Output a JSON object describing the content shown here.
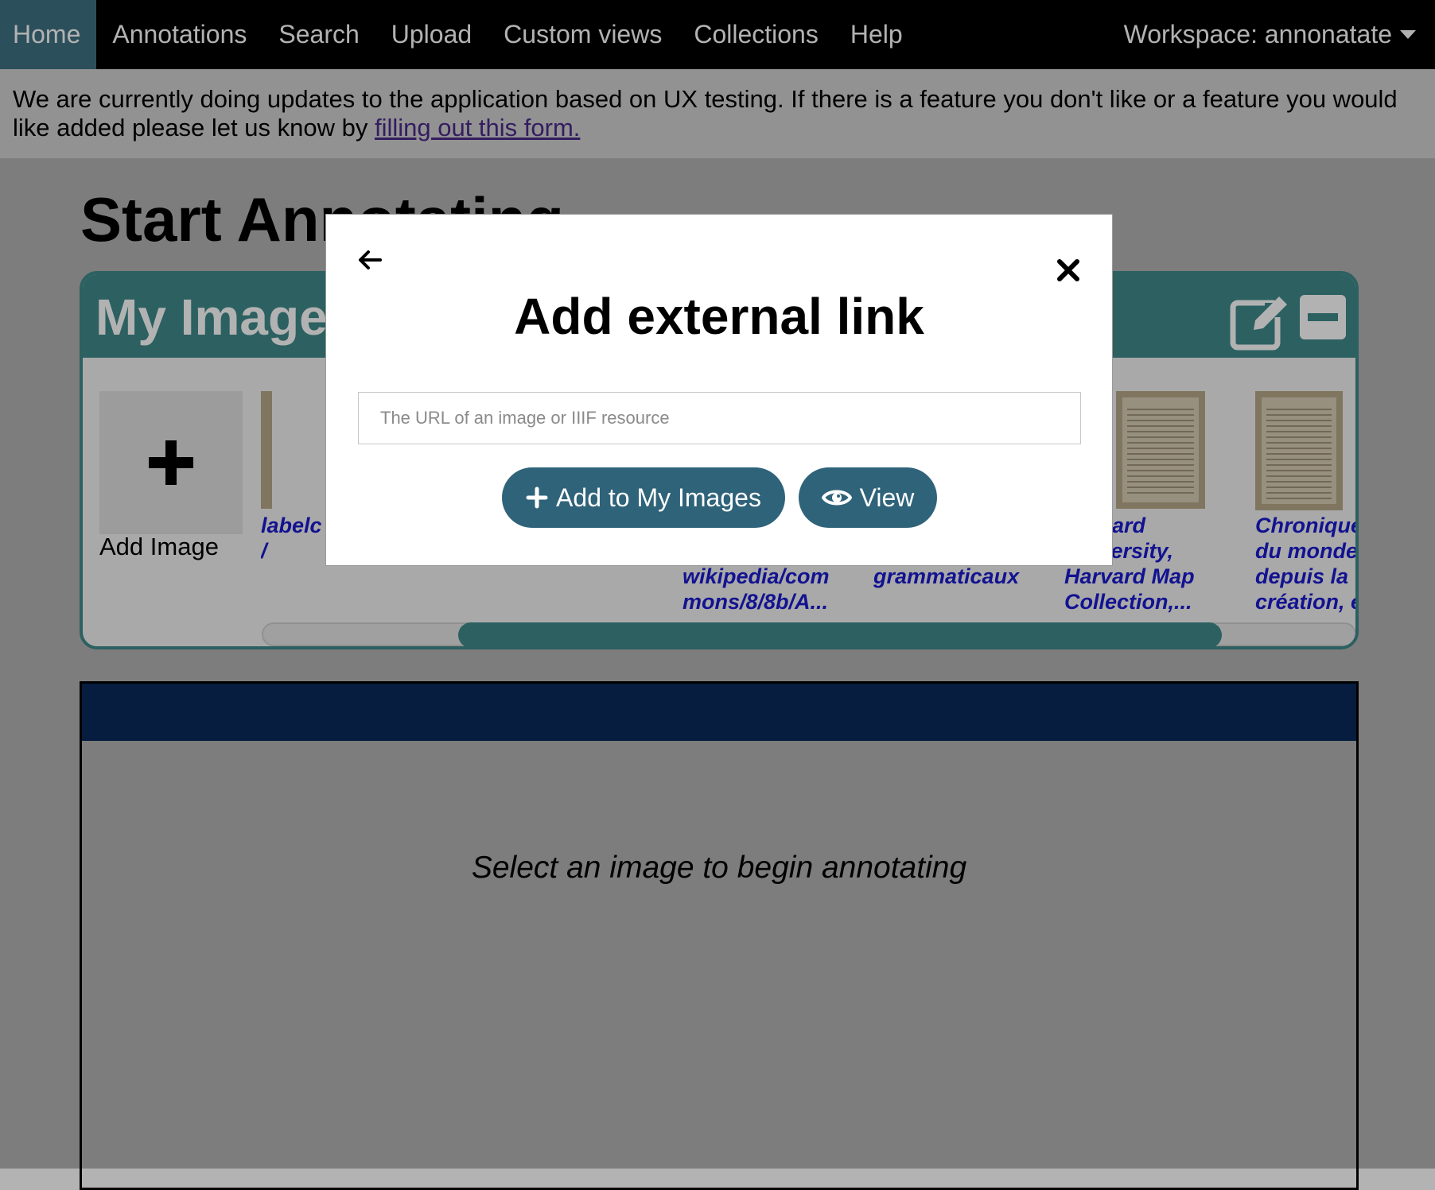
{
  "nav": {
    "items": [
      "Home",
      "Annotations",
      "Search",
      "Upload",
      "Custom views",
      "Collections",
      "Help"
    ],
    "active": "Home",
    "workspace": "Workspace: annonatate"
  },
  "banner": {
    "text": "We are currently doing updates to the application based on UX testing. If there is a feature you don't like or a feature you would like added please let us know by ",
    "link": "filling out this form."
  },
  "main": {
    "title": "Start Annotating",
    "panel": {
      "title": "My Images",
      "add_label": "Add Image",
      "captions": [
        "labelc\n/",
        "wikipedia/com\nmons/8/8b/A...",
        "grammaticaux",
        "Harvard\nUniversity,\nHarvard Map\nCollection,...",
        "Chronique\ndu monde\ndepuis la\ncréation, et"
      ]
    },
    "viewer": {
      "message": "Select an image to begin annotating"
    }
  },
  "modal": {
    "title": "Add external link",
    "input_placeholder": "The URL of an image or IIIF resource",
    "input_value": "",
    "add_button": "Add to My Images",
    "view_button": "View"
  },
  "icons": {
    "back": "arrow-left-icon",
    "close": "close-icon",
    "add": "plus-icon",
    "view": "eye-icon",
    "edit": "edit-icon",
    "collapse": "minus-icon"
  },
  "colors": {
    "nav_bg": "#000000",
    "nav_active": "#3f7184",
    "panel_accent": "#3f8a8c",
    "button": "#2f6379",
    "viewer_header": "#0a2a5c"
  }
}
